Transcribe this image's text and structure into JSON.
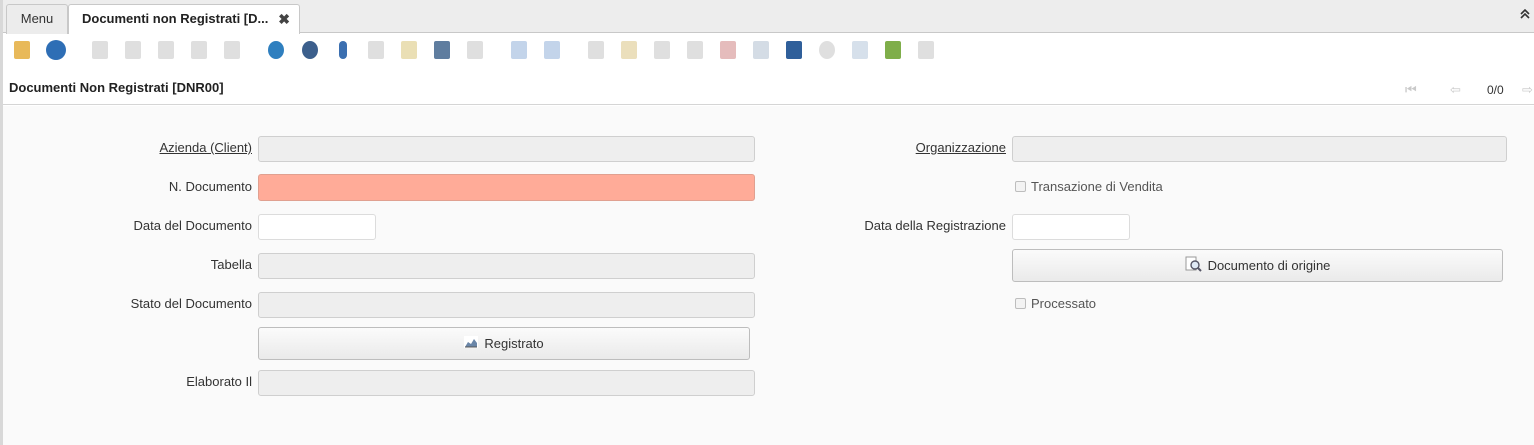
{
  "tabs": [
    {
      "label": "Menu"
    },
    {
      "label": "Documenti non Registrati [D...",
      "close": "✖"
    }
  ],
  "collapse_icon": "double-chevron-up",
  "toolbar": {
    "icons": [
      {
        "name": "undo-icon",
        "color": "#e8b95a",
        "enabled": true
      },
      {
        "name": "help-icon",
        "color": "#2e6eb5",
        "enabled": true
      },
      {
        "name": "new-record-icon",
        "color": "#d9d9d9",
        "enabled": false
      },
      {
        "name": "copy-record-icon",
        "color": "#d9d9d9",
        "enabled": false
      },
      {
        "name": "delete-icon",
        "color": "#d9d9d9",
        "enabled": false
      },
      {
        "name": "save-icon",
        "color": "#d9d9d9",
        "enabled": false
      },
      {
        "name": "save-new-icon",
        "color": "#d9d9d9",
        "enabled": false
      },
      {
        "name": "refresh-icon",
        "color": "#2f7fbf",
        "enabled": true
      },
      {
        "name": "find-icon",
        "color": "#3c5f8c",
        "enabled": true
      },
      {
        "name": "attachment-icon",
        "color": "#3b6fb0",
        "enabled": true
      },
      {
        "name": "chat-icon",
        "color": "#d9d9d9",
        "enabled": false
      },
      {
        "name": "post-it-icon",
        "color": "#e6d9a8",
        "enabled": false
      },
      {
        "name": "grid-toggle-icon",
        "color": "#5f7d9f",
        "enabled": true
      },
      {
        "name": "history-icon",
        "color": "#d9d9d9",
        "enabled": false
      },
      {
        "name": "parent-record-icon",
        "color": "#b8cde6",
        "enabled": false
      },
      {
        "name": "detail-record-icon",
        "color": "#b8cde6",
        "enabled": false
      },
      {
        "name": "report-icon",
        "color": "#d9d9d9",
        "enabled": false
      },
      {
        "name": "archive-icon",
        "color": "#e8d9b0",
        "enabled": false
      },
      {
        "name": "print-icon",
        "color": "#d9d9d9",
        "enabled": false
      },
      {
        "name": "zoom-across-icon",
        "color": "#d9d9d9",
        "enabled": false
      },
      {
        "name": "request-icon",
        "color": "#e0b0b0",
        "enabled": false
      },
      {
        "name": "product-info-icon",
        "color": "#cdd6e0",
        "enabled": false
      },
      {
        "name": "book-icon",
        "color": "#2f5f9a",
        "enabled": true
      },
      {
        "name": "workflow-icon",
        "color": "#d9d9d9",
        "enabled": false
      },
      {
        "name": "export-icon",
        "color": "#cfdbe8",
        "enabled": false
      },
      {
        "name": "import-icon",
        "color": "#7fae4a",
        "enabled": true
      },
      {
        "name": "customize-icon",
        "color": "#d9d9d9",
        "enabled": false
      }
    ]
  },
  "header": {
    "title": "Documenti Non Registrati [DNR00]",
    "nav_first": "⏮",
    "nav_prev": "⇦",
    "record_count": "0/0",
    "nav_next": "⇨"
  },
  "form": {
    "client_label": "Azienda (Client)",
    "client_value": "",
    "document_no_label": "N. Documento",
    "document_no_value": "",
    "date_doc_label": "Data del Documento",
    "date_doc_value": "",
    "table_label": "Tabella",
    "table_value": "",
    "doc_status_label": "Stato del Documento",
    "doc_status_value": "",
    "posted_button_label": "Registrato",
    "processed_on_label": "Elaborato Il",
    "processed_on_value": "",
    "org_label": "Organizzazione",
    "org_value": "",
    "sales_tx_label": "Transazione di Vendita",
    "sales_tx_checked": false,
    "date_acct_label": "Data della Registrazione",
    "date_acct_value": "",
    "source_doc_button_label": "Documento di origine",
    "processed_label": "Processato",
    "processed_checked": false
  },
  "colors": {
    "mandatory": "#ffab98",
    "readonly": "#eeeeee",
    "form_bg": "#fafafa"
  }
}
